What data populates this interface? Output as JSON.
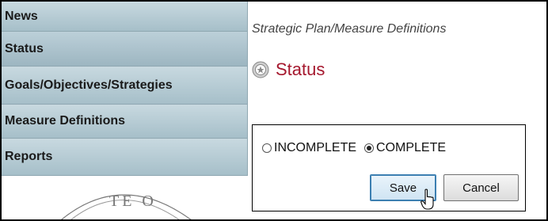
{
  "sidebar": {
    "items": [
      {
        "label": "News"
      },
      {
        "label": "Status"
      },
      {
        "label": "Goals/Objectives/Strategies"
      },
      {
        "label": "Measure Definitions"
      },
      {
        "label": "Reports"
      }
    ],
    "seal_text": "TE O"
  },
  "breadcrumb": "Strategic Plan/Measure Definitions",
  "title": {
    "icon": "seal-badge-icon",
    "text": "Status"
  },
  "status_form": {
    "options": [
      {
        "label": "INCOMPLETE",
        "selected": false
      },
      {
        "label": "COMPLETE",
        "selected": true
      }
    ],
    "save_label": "Save",
    "cancel_label": "Cancel"
  },
  "colors": {
    "title": "#a5182e",
    "nav_bg": "#b5cbd4"
  }
}
